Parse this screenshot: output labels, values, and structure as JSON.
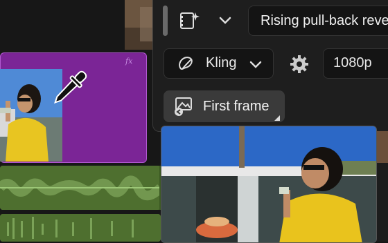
{
  "generation_panel": {
    "prompt": {
      "value": "Rising pull-back reve"
    },
    "model": {
      "label": "Kling",
      "icon": "kling-logo-icon"
    },
    "resolution": {
      "label": "1080p"
    },
    "reference_frame": {
      "label": "First frame",
      "icon": "image-frame-icon"
    }
  },
  "timeline": {
    "video_clip": {
      "fx_label": "fx",
      "color": "#7b2596"
    },
    "audio_color": "#4e6f2f"
  },
  "tool": {
    "cursor": "eyedropper-icon"
  }
}
